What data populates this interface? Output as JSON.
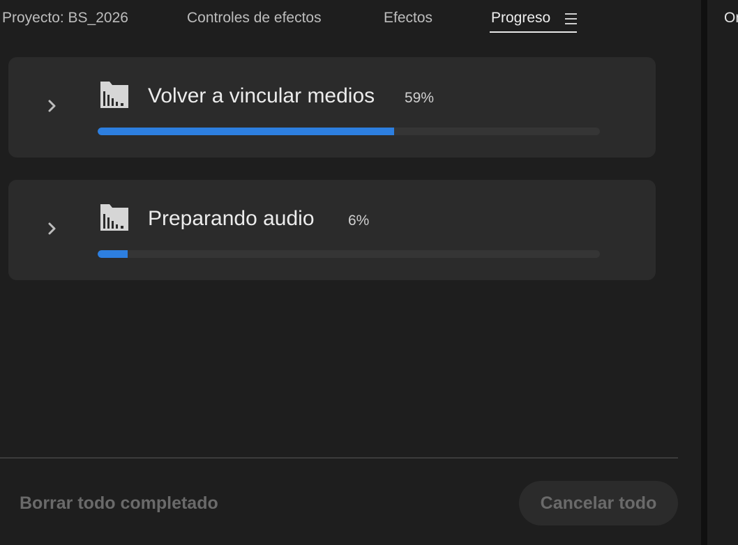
{
  "tabs": [
    {
      "label": "Proyecto: BS_2026",
      "active": false
    },
    {
      "label": "Controles de efectos",
      "active": false
    },
    {
      "label": "Efectos",
      "active": false
    },
    {
      "label": "Progreso",
      "active": true
    }
  ],
  "side_panel": {
    "tab_label": "Or"
  },
  "tasks": [
    {
      "title": "Volver a vincular medios",
      "percent_label": "59%",
      "progress": 0.59,
      "icon": "folder-media-icon"
    },
    {
      "title": "Preparando audio",
      "percent_label": "6%",
      "progress": 0.06,
      "icon": "folder-media-icon"
    }
  ],
  "footer": {
    "clear_label": "Borrar todo completado",
    "cancel_label": "Cancelar todo"
  },
  "colors": {
    "accent": "#2d7fe0",
    "card_bg": "#2b2b2b",
    "panel_bg": "#1e1e1e"
  }
}
